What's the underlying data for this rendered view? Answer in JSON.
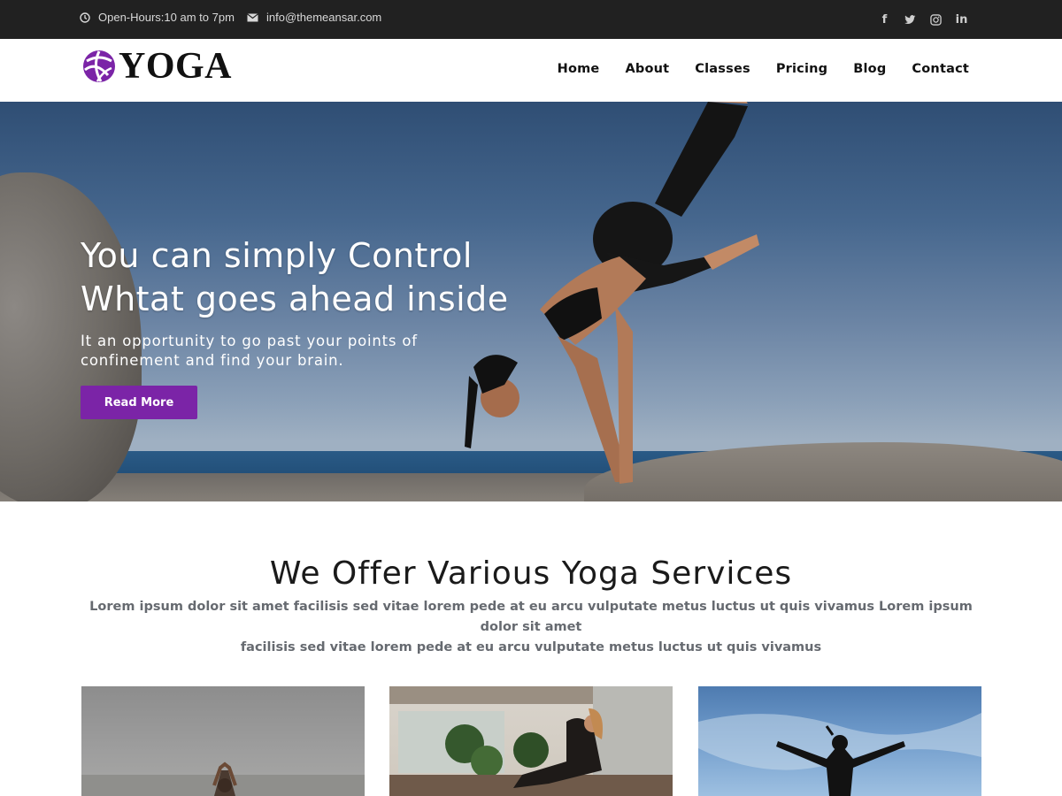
{
  "topbar": {
    "hours": "Open-Hours:10 am to 7pm",
    "email": "info@themeansar.com",
    "social": [
      {
        "icon": "facebook-icon",
        "glyph": "f"
      },
      {
        "icon": "twitter-icon",
        "glyph": "t"
      },
      {
        "icon": "instagram-icon",
        "glyph": "◎"
      },
      {
        "icon": "linkedin-icon",
        "glyph": "in"
      }
    ]
  },
  "header": {
    "logo_text": "YOGA",
    "nav": [
      "Home",
      "About",
      "Classes",
      "Pricing",
      "Blog",
      "Contact"
    ]
  },
  "hero": {
    "title_line1": "You can simply Control",
    "title_line2": "Whtat goes ahead inside",
    "subtitle": "It an opportunity to go past your points of confinement and find your brain.",
    "button": "Read More"
  },
  "services": {
    "title": "We Offer Various Yoga Services",
    "description_line1": "Lorem ipsum dolor sit amet facilisis sed vitae lorem pede at eu arcu vulputate metus luctus ut quis vivamus Lorem ipsum dolor sit amet",
    "description_line2": "facilisis sed vitae lorem pede at eu arcu vulputate metus luctus ut quis vivamus"
  },
  "colors": {
    "accent": "#7b24a7",
    "topbar_bg": "#212121"
  }
}
